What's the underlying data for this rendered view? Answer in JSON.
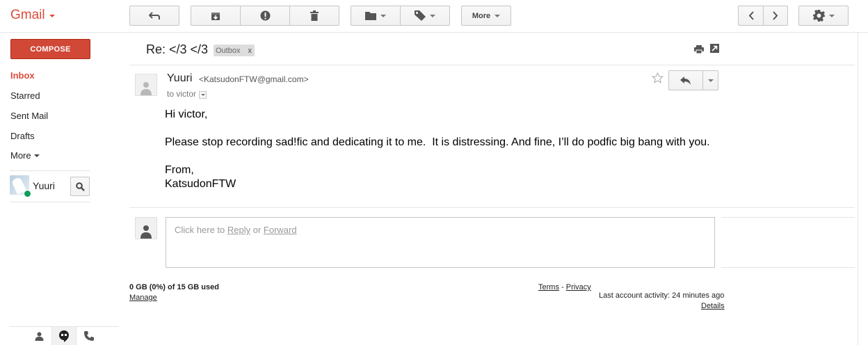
{
  "app": {
    "logo": "Gmail"
  },
  "toolbar": {
    "more_label": "More"
  },
  "nav": {
    "compose_label": "COMPOSE",
    "items": [
      {
        "label": "Inbox",
        "active": true
      },
      {
        "label": "Starred"
      },
      {
        "label": "Sent Mail"
      },
      {
        "label": "Drafts"
      },
      {
        "label": "More"
      }
    ]
  },
  "chat": {
    "contact_name": "Yuuri",
    "status_color": "#0f9d58"
  },
  "thread": {
    "subject": "Re: </3 </3",
    "label": "Outbox",
    "label_remove": "x"
  },
  "message": {
    "sender_name": "Yuuri",
    "sender_email": "<KatsudonFTW@gmail.com>",
    "to_line": "to victor",
    "greeting": "Hi victor,",
    "body": "Please stop recording sad!fic and dedicating it to me.  It is distressing. And fine, I’ll do podfic big bang with you.",
    "closing": "From,",
    "signature": "KatsudonFTW"
  },
  "reply_box": {
    "prefix": "Click here to ",
    "reply_link": "Reply",
    "middle": " or ",
    "forward_link": "Forward"
  },
  "footer": {
    "storage": "0 GB (0%) of 15 GB used",
    "manage": "Manage",
    "terms": "Terms",
    "separator": " - ",
    "privacy": "Privacy",
    "last_activity": "Last account activity: 24 minutes ago",
    "details": "Details"
  },
  "colors": {
    "brand_red": "#dd4b39",
    "compose_red": "#d14836"
  }
}
